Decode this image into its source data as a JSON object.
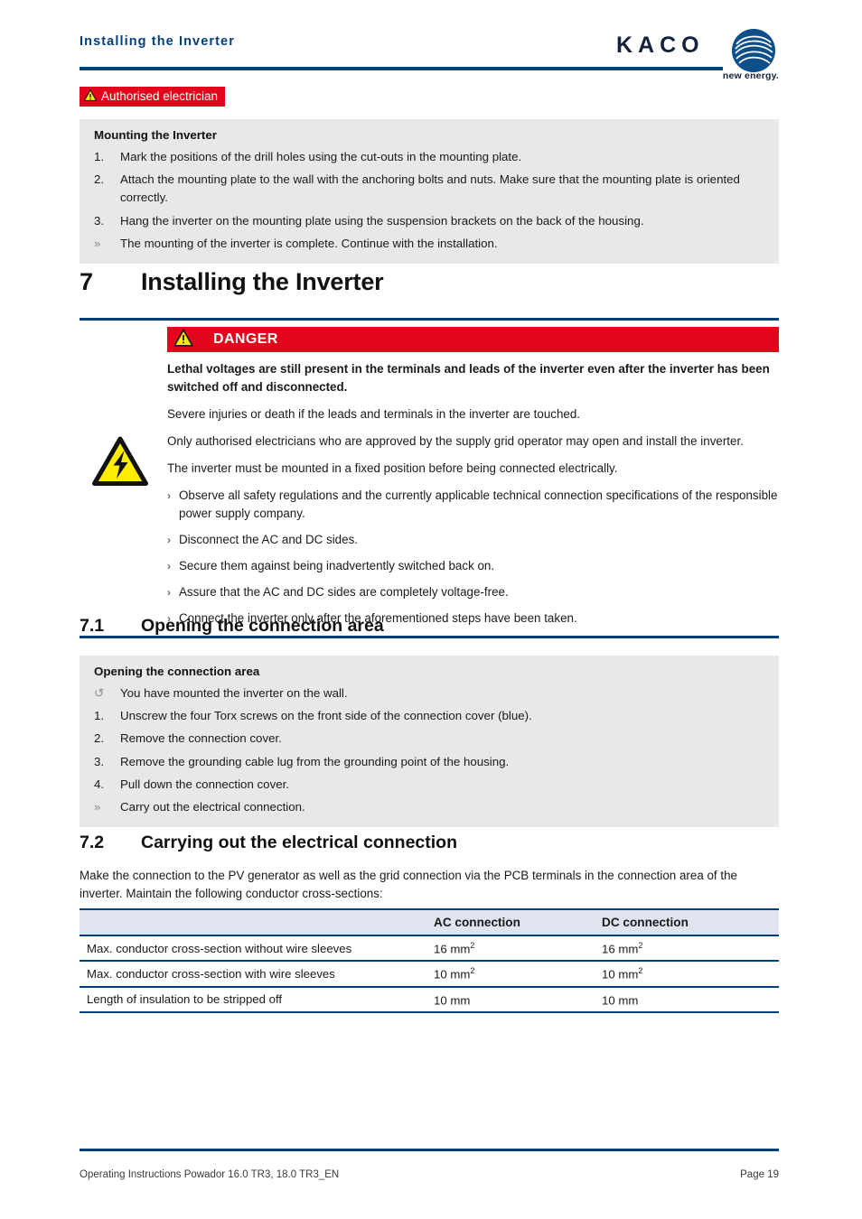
{
  "header": {
    "title": "Installing the Inverter",
    "logo_word": "KACO",
    "logo_tagline": "new energy."
  },
  "authorised_badge": {
    "label": "Authorised electrician",
    "icon": "warning-triangle-icon",
    "bg_color": "#e3051b",
    "text_color": "#ffffff"
  },
  "mounting_box": {
    "title": "Mounting the Inverter",
    "steps": [
      {
        "marker": "1.",
        "text": "Mark the positions of the drill holes using the cut-outs in the mounting plate."
      },
      {
        "marker": "2.",
        "text": "Attach the mounting plate to the wall with the anchoring bolts and nuts. Make sure that the mounting plate is oriented correctly."
      },
      {
        "marker": "3.",
        "text": "Hang the inverter on the mounting plate using the suspension brackets on the back of the housing."
      },
      {
        "marker": "»",
        "text": "The mounting of the inverter is complete. Continue with the installation."
      }
    ]
  },
  "chapter": {
    "number": "7",
    "title": "Installing the Inverter"
  },
  "danger": {
    "bar_label": "DANGER",
    "bar_icon": "warning-triangle-icon",
    "side_icon": "electric-shock-icon",
    "bar_color": "#e3051b",
    "lead": "Lethal voltages are still present in the terminals and leads of the inverter even after the inverter has been switched off and disconnected.",
    "paragraphs": [
      "Severe injuries or death if the leads and terminals in the inverter are touched.",
      "Only authorised electricians who are approved by the supply grid operator may open and install the inverter.",
      "The inverter must be mounted in a fixed position before being connected electrically."
    ],
    "bullet_marker": "›",
    "bullets": [
      "Observe all safety regulations and the currently applicable technical connection specifications of the responsible power supply company.",
      "Disconnect the AC and DC sides.",
      "Secure them against being inadvertently switched back on.",
      "Assure that the AC and DC sides are completely voltage-free.",
      "Connect the inverter only after the aforementioned steps have been taken."
    ]
  },
  "section_71": {
    "number": "7.1",
    "title": "Opening the connection area",
    "box": {
      "title": "Opening the connection area",
      "steps": [
        {
          "marker": "↺",
          "text": "You have mounted the inverter on the wall."
        },
        {
          "marker": "1.",
          "text": "Unscrew the four Torx screws on the front side of the connection cover (blue)."
        },
        {
          "marker": "2.",
          "text": "Remove the connection cover."
        },
        {
          "marker": "3.",
          "text": "Remove the grounding cable lug from the grounding point of the housing."
        },
        {
          "marker": "4.",
          "text": "Pull down the connection cover."
        },
        {
          "marker": "»",
          "text": "Carry out the electrical connection."
        }
      ]
    }
  },
  "section_72": {
    "number": "7.2",
    "title": "Carrying out the electrical connection",
    "intro": "Make the connection to the PV generator as well as the grid connection via the PCB terminals in the connection area of the inverter. Maintain the following conductor cross-sections:",
    "table": {
      "headers": [
        "",
        "AC connection",
        "DC connection"
      ],
      "rows": [
        {
          "label": "Max. conductor cross-section without wire sleeves",
          "ac": "16 mm",
          "ac_sup": "2",
          "dc": "16 mm",
          "dc_sup": "2"
        },
        {
          "label": "Max. conductor cross-section with wire sleeves",
          "ac": "10 mm",
          "ac_sup": "2",
          "dc": "10 mm",
          "dc_sup": "2"
        },
        {
          "label": "Length of insulation to be stripped off",
          "ac": "10 mm",
          "ac_sup": "",
          "dc": "10 mm",
          "dc_sup": ""
        }
      ]
    }
  },
  "footer": {
    "left": "Operating Instructions Powador 16.0 TR3, 18.0 TR3_EN",
    "right": "Page 19"
  },
  "colors": {
    "brand_navy": "#00407a",
    "brand_dark": "#14233c",
    "danger_red": "#e3051b",
    "warning_yellow": "#ffed00",
    "grey_box": "#e8e8e9",
    "table_head": "#e0e4ee"
  }
}
